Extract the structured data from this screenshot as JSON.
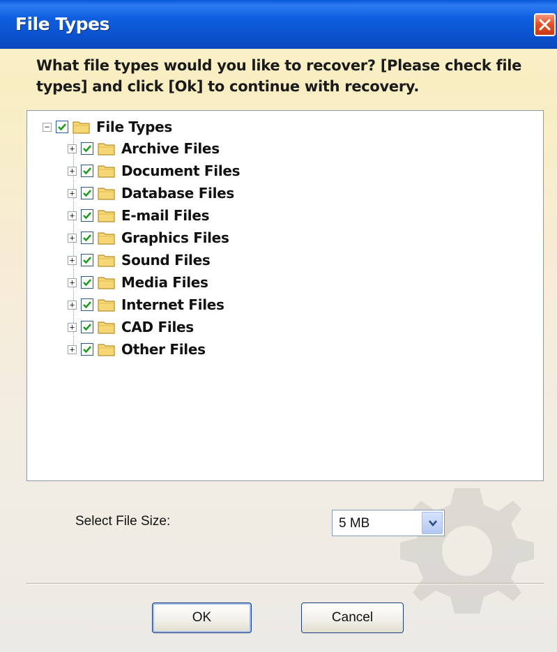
{
  "window": {
    "title": "File Types",
    "close_icon": "close-x-icon"
  },
  "instructions": "What file types would you like to recover? [Please check file types] and click [Ok] to continue with recovery.",
  "tree": {
    "root": {
      "label": "File Types",
      "checked": true,
      "expanded": true
    },
    "children": [
      {
        "label": "Archive Files",
        "checked": true
      },
      {
        "label": "Document Files",
        "checked": true
      },
      {
        "label": "Database Files",
        "checked": true
      },
      {
        "label": "E-mail Files",
        "checked": true
      },
      {
        "label": "Graphics Files",
        "checked": true
      },
      {
        "label": "Sound Files",
        "checked": true
      },
      {
        "label": "Media Files",
        "checked": true
      },
      {
        "label": "Internet Files",
        "checked": true
      },
      {
        "label": "CAD Files",
        "checked": true
      },
      {
        "label": "Other Files",
        "checked": true
      }
    ],
    "expand_symbol": "+",
    "collapse_symbol": "−"
  },
  "file_size": {
    "label": "Select File Size:",
    "selected": "5 MB"
  },
  "buttons": {
    "ok": "OK",
    "cancel": "Cancel"
  },
  "colors": {
    "titlebar": "#0a4fcb",
    "close": "#e3522a",
    "check": "#1e9a1e",
    "folder": "#f6d776"
  }
}
